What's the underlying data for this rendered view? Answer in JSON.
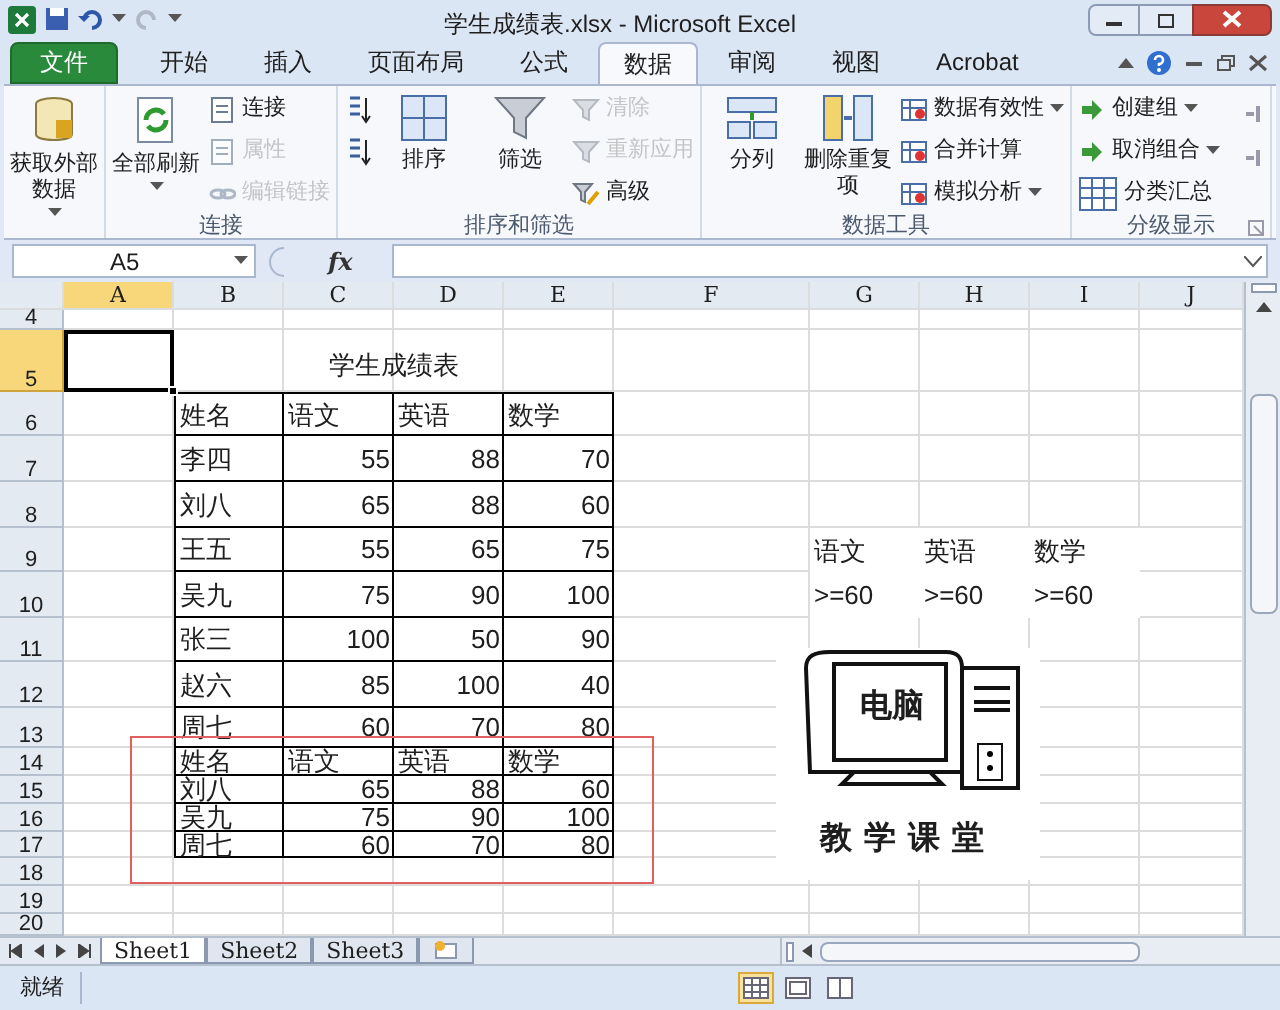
{
  "window": {
    "title": "学生成绩表.xlsx - Microsoft Excel"
  },
  "ribbon_tabs": [
    {
      "label": "文件",
      "kind": "file",
      "selected": false
    },
    {
      "label": "开始",
      "kind": "tab",
      "selected": false
    },
    {
      "label": "插入",
      "kind": "tab",
      "selected": false
    },
    {
      "label": "页面布局",
      "kind": "tab",
      "selected": false
    },
    {
      "label": "公式",
      "kind": "tab",
      "selected": false
    },
    {
      "label": "数据",
      "kind": "tab",
      "selected": true
    },
    {
      "label": "审阅",
      "kind": "tab",
      "selected": false
    },
    {
      "label": "视图",
      "kind": "tab",
      "selected": false
    },
    {
      "label": "Acrobat",
      "kind": "tab",
      "selected": false
    }
  ],
  "ribbon_groups": [
    {
      "items": [
        {
          "kind": "large",
          "label": "获取外部数据",
          "dropdown": true,
          "disabled": false
        }
      ]
    },
    {
      "label": "连接",
      "items": [
        {
          "kind": "large",
          "label": "全部刷新",
          "dropdown": true,
          "disabled": false
        },
        {
          "kind": "small",
          "label": "连接",
          "disabled": false
        },
        {
          "kind": "small",
          "label": "属性",
          "disabled": true
        },
        {
          "kind": "small",
          "label": "编辑链接",
          "disabled": true
        }
      ]
    },
    {
      "label": "排序和筛选",
      "items": [
        {
          "kind": "icon",
          "disabled": false
        },
        {
          "kind": "icon",
          "disabled": false
        },
        {
          "kind": "large",
          "label": "排序",
          "disabled": false
        },
        {
          "kind": "large",
          "label": "筛选",
          "disabled": false
        },
        {
          "kind": "small",
          "label": "清除",
          "disabled": true
        },
        {
          "kind": "small",
          "label": "重新应用",
          "disabled": true
        },
        {
          "kind": "small",
          "label": "高级",
          "disabled": false
        }
      ]
    },
    {
      "label": "数据工具",
      "items": [
        {
          "kind": "large",
          "label": "分列",
          "disabled": false
        },
        {
          "kind": "large",
          "label": "删除重复项",
          "disabled": false
        },
        {
          "kind": "small",
          "label": "数据有效性",
          "dropdown": true,
          "disabled": false
        },
        {
          "kind": "small",
          "label": "合并计算",
          "disabled": false
        },
        {
          "kind": "small",
          "label": "模拟分析",
          "dropdown": true,
          "disabled": false
        }
      ]
    },
    {
      "label": "分级显示",
      "items": [
        {
          "kind": "small",
          "label": "创建组",
          "dropdown": true,
          "disabled": false
        },
        {
          "kind": "small",
          "label": "取消组合",
          "dropdown": true,
          "disabled": false
        },
        {
          "kind": "small",
          "label": "分类汇总",
          "disabled": false
        }
      ]
    }
  ],
  "formula_bar": {
    "name_box": "A5",
    "function_label": "fx"
  },
  "columns": [
    {
      "label": "A",
      "selected": true
    },
    {
      "label": "B",
      "selected": false
    },
    {
      "label": "C",
      "selected": false
    },
    {
      "label": "D",
      "selected": false
    },
    {
      "label": "E",
      "selected": false
    },
    {
      "label": "F",
      "selected": false
    },
    {
      "label": "G",
      "selected": false
    },
    {
      "label": "H",
      "selected": false
    },
    {
      "label": "I",
      "selected": false
    },
    {
      "label": "J",
      "selected": false
    }
  ],
  "table_title": "学生成绩表",
  "rows": [
    {
      "header": "4",
      "selected": false,
      "cells": []
    },
    {
      "header": "5",
      "selected": true,
      "cells": []
    },
    {
      "header": "6",
      "selected": false,
      "cells": [
        null,
        {
          "value": "姓名",
          "kind": "text",
          "bordered": true
        },
        {
          "value": "语文",
          "kind": "text",
          "bordered": true
        },
        {
          "value": "英语",
          "kind": "text",
          "bordered": true
        },
        {
          "value": "数学",
          "kind": "text",
          "bordered": true
        }
      ]
    },
    {
      "header": "7",
      "selected": false,
      "cells": [
        null,
        {
          "value": "李四",
          "kind": "text",
          "bordered": true
        },
        {
          "value": "55",
          "kind": "number",
          "bordered": true
        },
        {
          "value": "88",
          "kind": "number",
          "bordered": true
        },
        {
          "value": "70",
          "kind": "number",
          "bordered": true
        }
      ]
    },
    {
      "header": "8",
      "selected": false,
      "cells": [
        null,
        {
          "value": "刘八",
          "kind": "text",
          "bordered": true
        },
        {
          "value": "65",
          "kind": "number",
          "bordered": true
        },
        {
          "value": "88",
          "kind": "number",
          "bordered": true
        },
        {
          "value": "60",
          "kind": "number",
          "bordered": true
        }
      ]
    },
    {
      "header": "9",
      "selected": false,
      "cells": [
        null,
        {
          "value": "王五",
          "kind": "text",
          "bordered": true
        },
        {
          "value": "55",
          "kind": "number",
          "bordered": true
        },
        {
          "value": "65",
          "kind": "number",
          "bordered": true
        },
        {
          "value": "75",
          "kind": "number",
          "bordered": true
        },
        null,
        {
          "value": "语文",
          "kind": "text",
          "bordered": false
        },
        {
          "value": "英语",
          "kind": "text",
          "bordered": false
        },
        {
          "value": "数学",
          "kind": "text",
          "bordered": false
        }
      ]
    },
    {
      "header": "10",
      "selected": false,
      "cells": [
        null,
        {
          "value": "吴九",
          "kind": "text",
          "bordered": true
        },
        {
          "value": "75",
          "kind": "number",
          "bordered": true
        },
        {
          "value": "90",
          "kind": "number",
          "bordered": true
        },
        {
          "value": "100",
          "kind": "number",
          "bordered": true
        },
        null,
        {
          "value": ">=60",
          "kind": "text",
          "bordered": false
        },
        {
          "value": ">=60",
          "kind": "text",
          "bordered": false
        },
        {
          "value": ">=60",
          "kind": "text",
          "bordered": false
        }
      ]
    },
    {
      "header": "11",
      "selected": false,
      "cells": [
        null,
        {
          "value": "张三",
          "kind": "text",
          "bordered": true
        },
        {
          "value": "100",
          "kind": "number",
          "bordered": true
        },
        {
          "value": "50",
          "kind": "number",
          "bordered": true
        },
        {
          "value": "90",
          "kind": "number",
          "bordered": true
        }
      ]
    },
    {
      "header": "12",
      "selected": false,
      "cells": [
        null,
        {
          "value": "赵六",
          "kind": "text",
          "bordered": true
        },
        {
          "value": "85",
          "kind": "number",
          "bordered": true
        },
        {
          "value": "100",
          "kind": "number",
          "bordered": true
        },
        {
          "value": "40",
          "kind": "number",
          "bordered": true
        }
      ]
    },
    {
      "header": "13",
      "selected": false,
      "cells": [
        null,
        {
          "value": "周七",
          "kind": "text",
          "bordered": true
        },
        {
          "value": "60",
          "kind": "number",
          "bordered": true
        },
        {
          "value": "70",
          "kind": "number",
          "bordered": true
        },
        {
          "value": "80",
          "kind": "number",
          "bordered": true
        }
      ]
    },
    {
      "header": "14",
      "selected": false,
      "cells": [
        null,
        {
          "value": "姓名",
          "kind": "text",
          "bordered": true
        },
        {
          "value": "语文",
          "kind": "text",
          "bordered": true
        },
        {
          "value": "英语",
          "kind": "text",
          "bordered": true
        },
        {
          "value": "数学",
          "kind": "text",
          "bordered": true
        }
      ]
    },
    {
      "header": "15",
      "selected": false,
      "cells": [
        null,
        {
          "value": "刘八",
          "kind": "text",
          "bordered": true
        },
        {
          "value": "65",
          "kind": "number",
          "bordered": true
        },
        {
          "value": "88",
          "kind": "number",
          "bordered": true
        },
        {
          "value": "60",
          "kind": "number",
          "bordered": true
        }
      ]
    },
    {
      "header": "16",
      "selected": false,
      "cells": [
        null,
        {
          "value": "吴九",
          "kind": "text",
          "bordered": true
        },
        {
          "value": "75",
          "kind": "number",
          "bordered": true
        },
        {
          "value": "90",
          "kind": "number",
          "bordered": true
        },
        {
          "value": "100",
          "kind": "number",
          "bordered": true
        }
      ]
    },
    {
      "header": "17",
      "selected": false,
      "cells": [
        null,
        {
          "value": "周七",
          "kind": "text",
          "bordered": true
        },
        {
          "value": "60",
          "kind": "number",
          "bordered": true
        },
        {
          "value": "70",
          "kind": "number",
          "bordered": true
        },
        {
          "value": "80",
          "kind": "number",
          "bordered": true
        }
      ]
    },
    {
      "header": "18",
      "selected": false,
      "cells": []
    },
    {
      "header": "19",
      "selected": false,
      "cells": []
    },
    {
      "header": "20",
      "selected": false,
      "cells": []
    }
  ],
  "highlight_frame": true,
  "clipart": {
    "screen_text": "电脑",
    "caption": "教学课堂"
  },
  "sheet_tabs": [
    {
      "label": "Sheet1",
      "selected": true
    },
    {
      "label": "Sheet2",
      "selected": false
    },
    {
      "label": "Sheet3",
      "selected": false
    }
  ],
  "status_bar": {
    "text": "就绪",
    "views": [
      {
        "selected": true
      },
      {
        "selected": false
      },
      {
        "selected": false
      }
    ]
  }
}
